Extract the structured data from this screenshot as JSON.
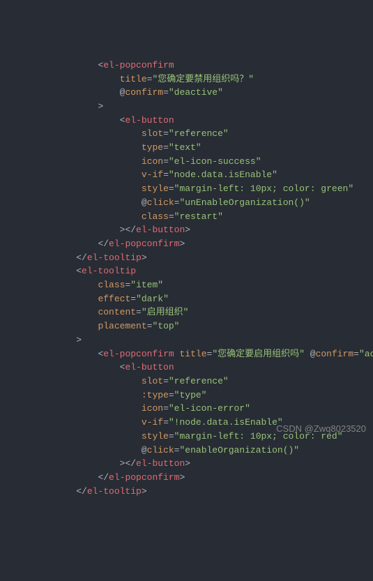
{
  "lines": [
    {
      "indent": 6,
      "parts": [
        {
          "t": "punct",
          "v": "<"
        },
        {
          "t": "tag",
          "v": "el-popconfirm"
        }
      ]
    },
    {
      "indent": 8,
      "parts": [
        {
          "t": "attr",
          "v": "title"
        },
        {
          "t": "eq",
          "v": "="
        },
        {
          "t": "str",
          "v": "\"您确定要禁用组织吗？\""
        }
      ]
    },
    {
      "indent": 8,
      "parts": [
        {
          "t": "at",
          "v": "@"
        },
        {
          "t": "attr",
          "v": "confirm"
        },
        {
          "t": "eq",
          "v": "="
        },
        {
          "t": "str",
          "v": "\"deactive\""
        }
      ]
    },
    {
      "indent": 6,
      "parts": [
        {
          "t": "punct",
          "v": ">"
        }
      ]
    },
    {
      "indent": 8,
      "parts": [
        {
          "t": "punct",
          "v": "<"
        },
        {
          "t": "tag",
          "v": "el-button"
        }
      ]
    },
    {
      "indent": 10,
      "parts": [
        {
          "t": "attr",
          "v": "slot"
        },
        {
          "t": "eq",
          "v": "="
        },
        {
          "t": "str",
          "v": "\"reference\""
        }
      ]
    },
    {
      "indent": 10,
      "parts": [
        {
          "t": "attr",
          "v": "type"
        },
        {
          "t": "eq",
          "v": "="
        },
        {
          "t": "str",
          "v": "\"text\""
        }
      ]
    },
    {
      "indent": 10,
      "parts": [
        {
          "t": "attr",
          "v": "icon"
        },
        {
          "t": "eq",
          "v": "="
        },
        {
          "t": "str",
          "v": "\"el-icon-success\""
        }
      ]
    },
    {
      "indent": 10,
      "parts": [
        {
          "t": "attr",
          "v": "v-if"
        },
        {
          "t": "eq",
          "v": "="
        },
        {
          "t": "str",
          "v": "\"node.data.isEnable\""
        }
      ]
    },
    {
      "indent": 10,
      "parts": [
        {
          "t": "attr",
          "v": "style"
        },
        {
          "t": "eq",
          "v": "="
        },
        {
          "t": "str",
          "v": "\"margin-left: 10px; color: green\""
        }
      ]
    },
    {
      "indent": 10,
      "parts": [
        {
          "t": "at",
          "v": "@"
        },
        {
          "t": "attr",
          "v": "click"
        },
        {
          "t": "eq",
          "v": "="
        },
        {
          "t": "str",
          "v": "\"unEnableOrganization()\""
        }
      ]
    },
    {
      "indent": 10,
      "parts": [
        {
          "t": "attr",
          "v": "class"
        },
        {
          "t": "eq",
          "v": "="
        },
        {
          "t": "str",
          "v": "\"restart\""
        }
      ]
    },
    {
      "indent": 8,
      "parts": [
        {
          "t": "punct",
          "v": "></"
        },
        {
          "t": "tag",
          "v": "el-button"
        },
        {
          "t": "punct",
          "v": ">"
        }
      ]
    },
    {
      "indent": 6,
      "parts": [
        {
          "t": "punct",
          "v": "</"
        },
        {
          "t": "tag",
          "v": "el-popconfirm"
        },
        {
          "t": "punct",
          "v": ">"
        }
      ]
    },
    {
      "indent": 4,
      "parts": [
        {
          "t": "punct",
          "v": "</"
        },
        {
          "t": "tag",
          "v": "el-tooltip"
        },
        {
          "t": "punct",
          "v": ">"
        }
      ]
    },
    {
      "indent": 4,
      "parts": [
        {
          "t": "punct",
          "v": "<"
        },
        {
          "t": "tag",
          "v": "el-tooltip"
        }
      ]
    },
    {
      "indent": 6,
      "parts": [
        {
          "t": "attr",
          "v": "class"
        },
        {
          "t": "eq",
          "v": "="
        },
        {
          "t": "str",
          "v": "\"item\""
        }
      ]
    },
    {
      "indent": 6,
      "parts": [
        {
          "t": "attr",
          "v": "effect"
        },
        {
          "t": "eq",
          "v": "="
        },
        {
          "t": "str",
          "v": "\"dark\""
        }
      ]
    },
    {
      "indent": 6,
      "parts": [
        {
          "t": "attr",
          "v": "content"
        },
        {
          "t": "eq",
          "v": "="
        },
        {
          "t": "str",
          "v": "\"启用组织\""
        }
      ]
    },
    {
      "indent": 6,
      "parts": [
        {
          "t": "attr",
          "v": "placement"
        },
        {
          "t": "eq",
          "v": "="
        },
        {
          "t": "str",
          "v": "\"top\""
        }
      ]
    },
    {
      "indent": 4,
      "parts": [
        {
          "t": "punct",
          "v": ">"
        }
      ]
    },
    {
      "indent": 6,
      "parts": [
        {
          "t": "punct",
          "v": "<"
        },
        {
          "t": "tag",
          "v": "el-popconfirm"
        },
        {
          "t": "punct",
          "v": " "
        },
        {
          "t": "attr",
          "v": "title"
        },
        {
          "t": "eq",
          "v": "="
        },
        {
          "t": "str",
          "v": "\"您确定要启用组织吗\""
        },
        {
          "t": "punct",
          "v": " "
        },
        {
          "t": "at",
          "v": "@"
        },
        {
          "t": "attr",
          "v": "confirm"
        },
        {
          "t": "eq",
          "v": "="
        },
        {
          "t": "str",
          "v": "\"active\""
        }
      ]
    },
    {
      "indent": 8,
      "parts": [
        {
          "t": "punct",
          "v": "<"
        },
        {
          "t": "tag",
          "v": "el-button"
        }
      ]
    },
    {
      "indent": 10,
      "parts": [
        {
          "t": "attr",
          "v": "slot"
        },
        {
          "t": "eq",
          "v": "="
        },
        {
          "t": "str",
          "v": "\"reference\""
        }
      ]
    },
    {
      "indent": 10,
      "parts": [
        {
          "t": "attr",
          "v": ":type"
        },
        {
          "t": "eq",
          "v": "="
        },
        {
          "t": "str",
          "v": "\"type\""
        }
      ]
    },
    {
      "indent": 10,
      "parts": [
        {
          "t": "attr",
          "v": "icon"
        },
        {
          "t": "eq",
          "v": "="
        },
        {
          "t": "str",
          "v": "\"el-icon-error\""
        }
      ]
    },
    {
      "indent": 10,
      "parts": [
        {
          "t": "attr",
          "v": "v-if"
        },
        {
          "t": "eq",
          "v": "="
        },
        {
          "t": "str",
          "v": "\"!node.data.isEnable\""
        }
      ]
    },
    {
      "indent": 10,
      "parts": [
        {
          "t": "attr",
          "v": "style"
        },
        {
          "t": "eq",
          "v": "="
        },
        {
          "t": "str",
          "v": "\"margin-left: 10px; color: red\""
        }
      ]
    },
    {
      "indent": 10,
      "parts": [
        {
          "t": "at",
          "v": "@"
        },
        {
          "t": "attr",
          "v": "click"
        },
        {
          "t": "eq",
          "v": "="
        },
        {
          "t": "str",
          "v": "\"enableOrganization()\""
        }
      ]
    },
    {
      "indent": 8,
      "parts": [
        {
          "t": "punct",
          "v": "></"
        },
        {
          "t": "tag",
          "v": "el-button"
        },
        {
          "t": "punct",
          "v": ">"
        }
      ]
    },
    {
      "indent": 6,
      "parts": [
        {
          "t": "punct",
          "v": "</"
        },
        {
          "t": "tag",
          "v": "el-popconfirm"
        },
        {
          "t": "punct",
          "v": ">"
        }
      ]
    },
    {
      "indent": 4,
      "parts": [
        {
          "t": "punct",
          "v": "</"
        },
        {
          "t": "tag",
          "v": "el-tooltip"
        },
        {
          "t": "punct",
          "v": ">"
        }
      ]
    }
  ],
  "indent_unit": "  ",
  "base_pad": "      ",
  "watermark": "CSDN @Zwq8023520"
}
